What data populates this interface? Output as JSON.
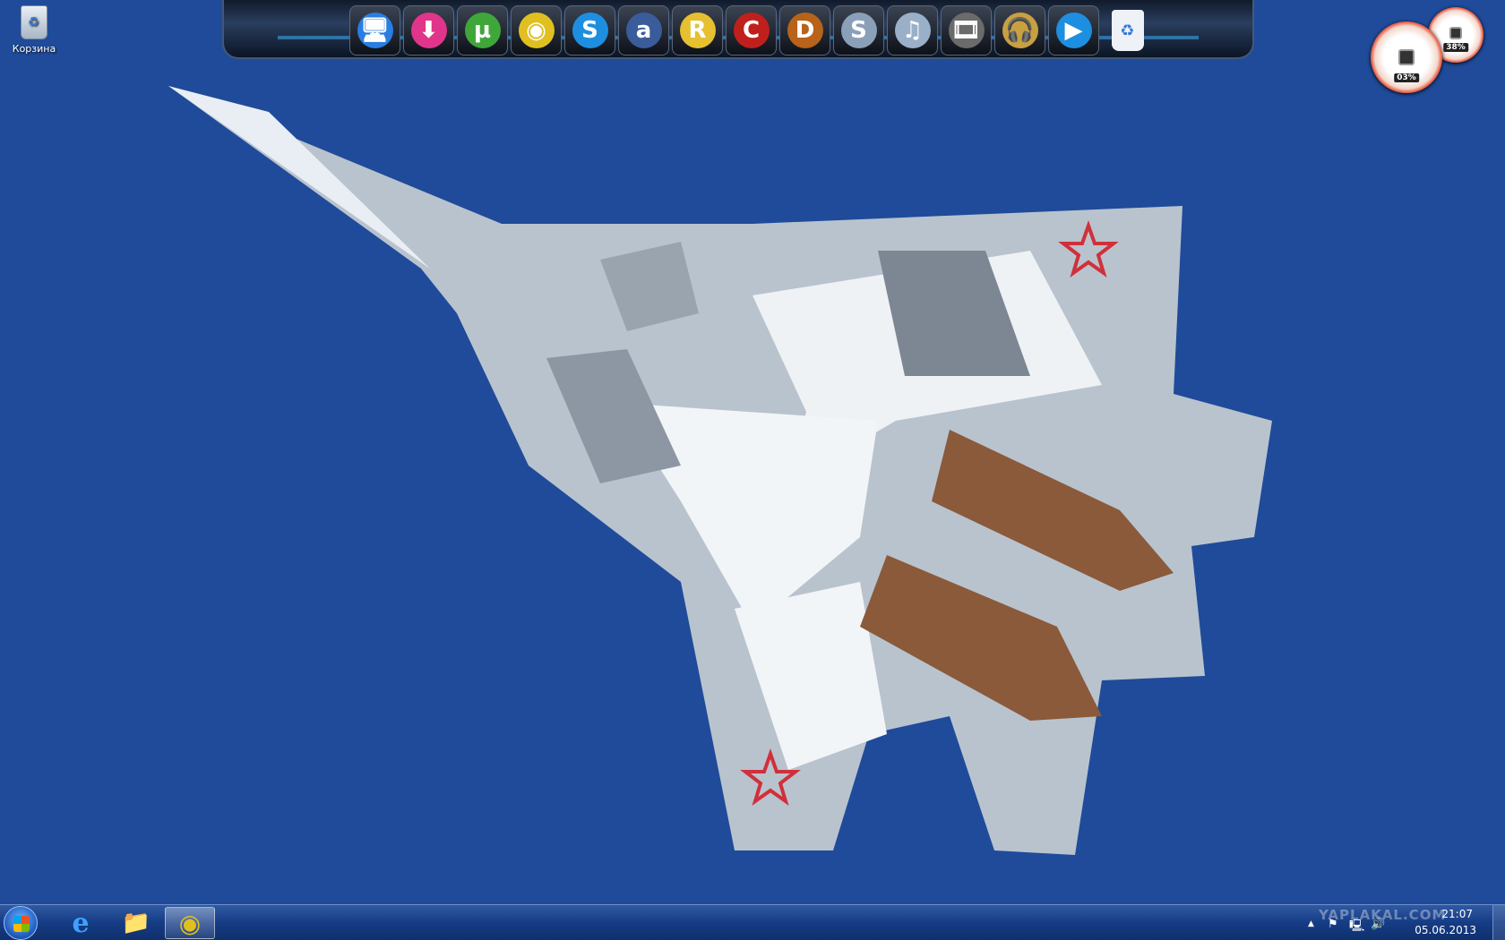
{
  "desktop": {
    "recycle_bin_label": "Корзина"
  },
  "dock": {
    "icons": [
      {
        "name": "computer",
        "glyph": "🖥",
        "color": "#2a7de1"
      },
      {
        "name": "download-master",
        "glyph": "⬇",
        "color": "#e0358a"
      },
      {
        "name": "utorrent",
        "glyph": "µ",
        "color": "#3fa73a"
      },
      {
        "name": "chrome",
        "glyph": "◉",
        "color": "#e0c020"
      },
      {
        "name": "skype",
        "glyph": "S",
        "color": "#1e8fe0"
      },
      {
        "name": "aimp",
        "glyph": "a",
        "color": "#3b5c9a"
      },
      {
        "name": "r-tool",
        "glyph": "R",
        "color": "#e6c030"
      },
      {
        "name": "ccleaner",
        "glyph": "C",
        "color": "#c0201c"
      },
      {
        "name": "diablo",
        "glyph": "D",
        "color": "#b8621a"
      },
      {
        "name": "video-player",
        "glyph": "S",
        "color": "#8aa0b8"
      },
      {
        "name": "media-center",
        "glyph": "♫",
        "color": "#9ab0c8"
      },
      {
        "name": "movie-maker",
        "glyph": "🎞",
        "color": "#6b6b6b"
      },
      {
        "name": "headphones-player",
        "glyph": "🎧",
        "color": "#c8a040"
      },
      {
        "name": "media-player",
        "glyph": "▶",
        "color": "#1e8fe0"
      }
    ],
    "trash_glyph": "♻"
  },
  "gadgets": {
    "cpu_percent": "03%",
    "ram_percent": "38%"
  },
  "taskbar": {
    "pinned": [
      {
        "name": "internet-explorer",
        "glyph": "e"
      },
      {
        "name": "file-explorer",
        "glyph": "📁"
      },
      {
        "name": "chrome",
        "glyph": "◉"
      }
    ],
    "tray": {
      "watermark": "YAPLAKAL.COM",
      "time": "21:07",
      "date": "05.06.2013",
      "show_hidden": "▲",
      "flag": "⚑",
      "network": "🖳",
      "volume": "🔊"
    }
  },
  "colors": {
    "sky": "#1f4b9a",
    "jet": "#c9d2db",
    "star": "#d0303a"
  }
}
